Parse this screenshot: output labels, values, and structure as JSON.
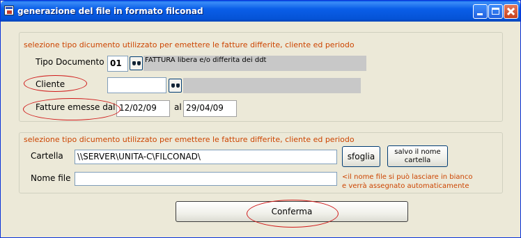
{
  "window": {
    "title": "generazione del file in formato filconad",
    "controls": {
      "minimize": "minimize-icon",
      "maximize": "maximize-icon",
      "close": "close-icon"
    }
  },
  "group1": {
    "title": "selezione tipo dicumento utilizzato per emettere le fatture differite, cliente ed periodo",
    "tipo_documento": {
      "label": "Tipo Documento",
      "code": "01",
      "description": "FATTURA libera e/o differita dei ddt"
    },
    "cliente": {
      "label": "Cliente",
      "value": "",
      "description": ""
    },
    "fatture": {
      "label": "Fatture emesse dal",
      "from": "12/02/09",
      "to_label": "al",
      "to": "29/04/09"
    }
  },
  "group2": {
    "title": "selezione tipo dicumento utilizzato per emettere le fatture differite, cliente ed periodo",
    "cartella": {
      "label": "Cartella",
      "value": "\\\\SERVER\\UNITA-C\\FILCONAD\\"
    },
    "sfoglia_label": "sfoglia",
    "salvo": {
      "line1": "salvo il nome",
      "line2": "cartella"
    },
    "nome_file": {
      "label": "Nome file",
      "value": ""
    },
    "note": {
      "line1": "<il nome file si può lasciare in bianco",
      "line2": "e verrà assegnato automaticamente"
    }
  },
  "confirm_label": "Conferma",
  "colors": {
    "accent_text": "#cc4400",
    "annotation": "#d01818",
    "titlebar": "#0a5ee8"
  },
  "icons": {
    "search": "binoculars-icon",
    "app": "app-icon"
  }
}
